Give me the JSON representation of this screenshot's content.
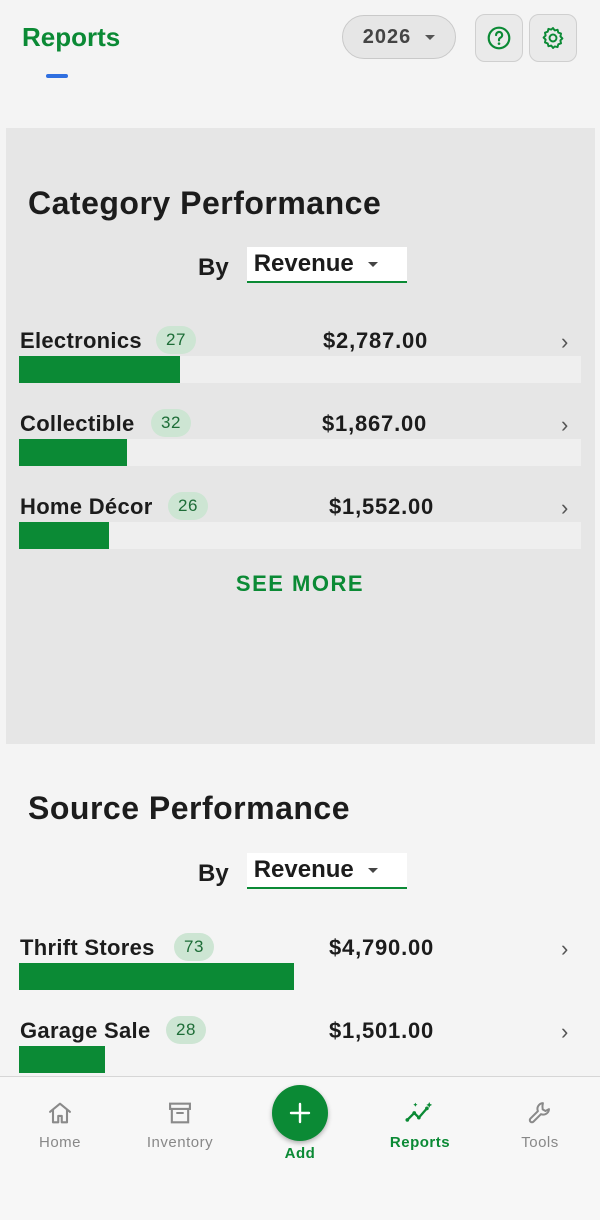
{
  "header": {
    "title": "Reports",
    "year": "2026"
  },
  "category_section": {
    "title": "Category Performance",
    "by_label": "By",
    "metric": "Revenue",
    "rows": [
      {
        "name": "Electronics",
        "count": "27",
        "amount": "$2,787.00",
        "value": 2787
      },
      {
        "name": "Collectible",
        "count": "32",
        "amount": "$1,867.00",
        "value": 1867
      },
      {
        "name": "Home Décor",
        "count": "26",
        "amount": "$1,552.00",
        "value": 1552
      }
    ],
    "see_more": "SEE MORE"
  },
  "source_section": {
    "title": "Source Performance",
    "by_label": "By",
    "metric": "Revenue",
    "rows": [
      {
        "name": "Thrift Stores",
        "count": "73",
        "amount": "$4,790.00",
        "value": 4790
      },
      {
        "name": "Garage Sale",
        "count": "28",
        "amount": "$1,501.00",
        "value": 1501
      }
    ]
  },
  "nav": {
    "items": [
      {
        "label": "Home",
        "icon": "home-icon"
      },
      {
        "label": "Inventory",
        "icon": "archive-icon"
      },
      {
        "label": "Add",
        "icon": "plus-icon"
      },
      {
        "label": "Reports",
        "icon": "trend-sparkle-icon"
      },
      {
        "label": "Tools",
        "icon": "wrench-icon"
      }
    ],
    "active": "Reports"
  },
  "colors": {
    "accent": "#0b8a35",
    "badge_bg": "#cde5d3",
    "card_bg": "#e6e6e6",
    "page_bg": "#f4f4f4"
  }
}
